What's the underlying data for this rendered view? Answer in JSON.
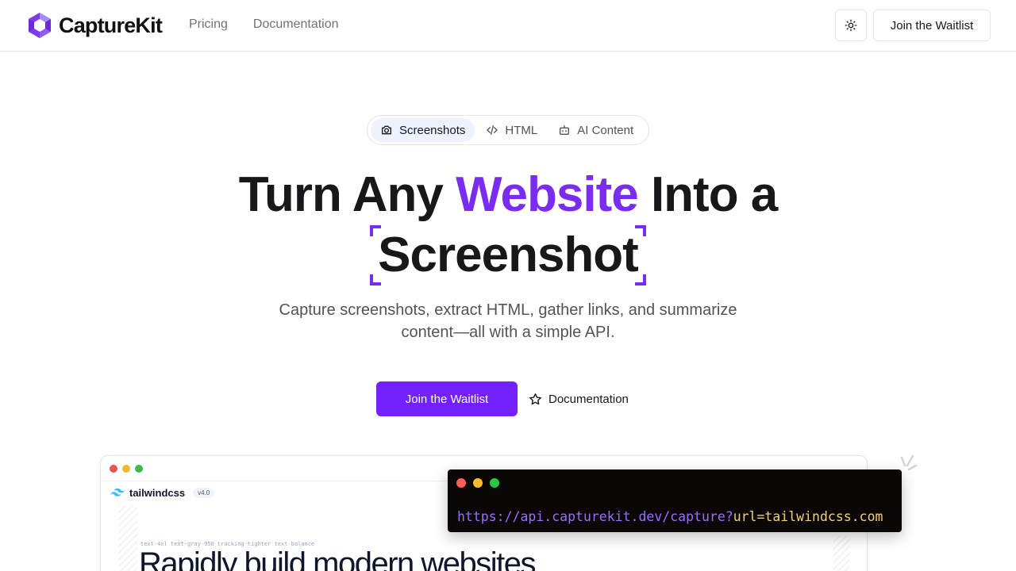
{
  "brand": {
    "name": "CaptureKit",
    "accent": "#7b2cf2",
    "primary_button": "#7520ff"
  },
  "nav": {
    "links": [
      "Pricing",
      "Documentation"
    ]
  },
  "header": {
    "theme_toggle_icon": "sun-icon",
    "waitlist_label": "Join the Waitlist"
  },
  "tabs": [
    {
      "label": "Screenshots",
      "icon": "camera-icon",
      "active": true
    },
    {
      "label": "HTML",
      "icon": "code-icon",
      "active": false
    },
    {
      "label": "AI Content",
      "icon": "bot-icon",
      "active": false
    }
  ],
  "hero": {
    "headline_part1": "Turn Any ",
    "headline_accent": "Website",
    "headline_part2": " Into a",
    "headline_line2": "Screenshot",
    "subtitle": "Capture screenshots, extract HTML, gather links, and summarize content—all with a simple API.",
    "primary_cta": "Join the Waitlist",
    "secondary_cta": "Documentation",
    "secondary_cta_icon": "star-icon"
  },
  "preview": {
    "site_name": "tailwindcss",
    "site_version": "v4.0",
    "caption_small": "text-4xl text-gray-950 tracking-tighter text-balance",
    "heading": "Rapidly build modern websites",
    "window_dots": [
      "#f05252",
      "#f5b82e",
      "#3dbb4d"
    ]
  },
  "terminal": {
    "url_base": "https://api.capturekit.dev/capture?",
    "url_param": "url=tailwindcss.com",
    "window_dots": [
      "#ff5f57",
      "#febc2e",
      "#28c840"
    ]
  }
}
